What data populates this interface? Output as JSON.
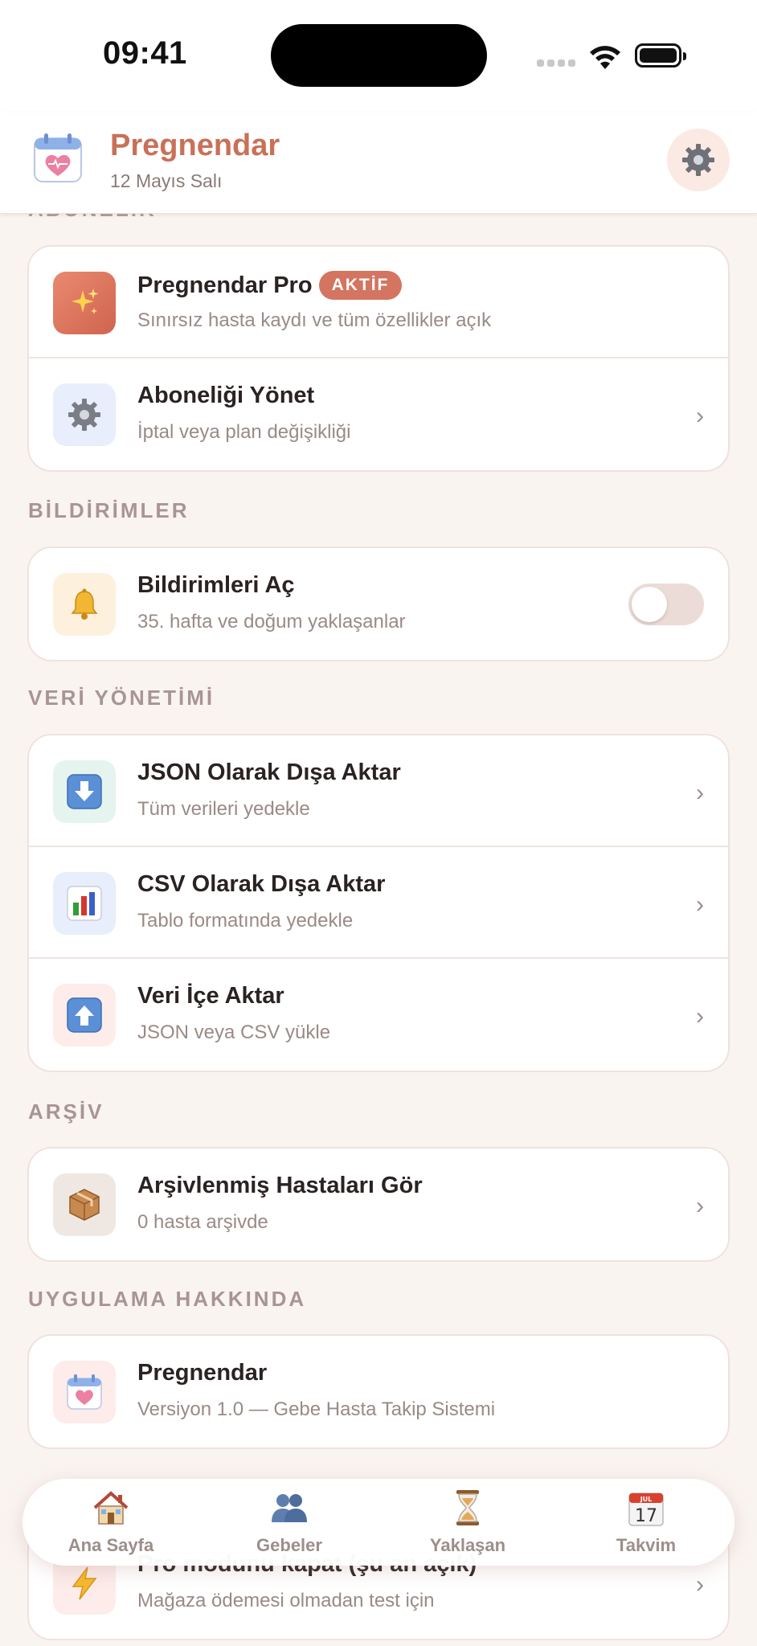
{
  "status_bar": {
    "time": "09:41"
  },
  "header": {
    "title": "Pregnendar",
    "date": "12 Mayıs Salı"
  },
  "sections": {
    "subscriptions": {
      "title": "ABONELİK",
      "items": [
        {
          "title": "Pregnendar Pro",
          "badge": "AKTİF",
          "subtitle": "Sınırsız hasta kaydı ve tüm özellikler açık",
          "icon": "sparkles-icon"
        },
        {
          "title": "Aboneliği Yönet",
          "subtitle": "İptal veya plan değişikliği",
          "icon": "gear-icon"
        }
      ]
    },
    "notifications": {
      "title": "BİLDİRİMLER",
      "items": [
        {
          "title": "Bildirimleri Aç",
          "subtitle": "35. hafta ve doğum yaklaşanlar",
          "icon": "bell-icon",
          "enabled": false
        }
      ]
    },
    "data_management": {
      "title": "VERİ YÖNETİMİ",
      "items": [
        {
          "title": "JSON Olarak Dışa Aktar",
          "subtitle": "Tüm verileri yedekle",
          "icon": "download-arrow-icon"
        },
        {
          "title": "CSV Olarak Dışa Aktar",
          "subtitle": "Tablo formatında yedekle",
          "icon": "bar-chart-icon"
        },
        {
          "title": "Veri İçe Aktar",
          "subtitle": "JSON veya CSV yükle",
          "icon": "upload-arrow-icon"
        }
      ]
    },
    "archive": {
      "title": "ARŞİV",
      "items": [
        {
          "title": "Arşivlenmiş Hastaları Gör",
          "subtitle": "0 hasta arşivde",
          "icon": "package-icon"
        }
      ]
    },
    "about": {
      "title": "UYGULAMA HAKKINDA",
      "items": [
        {
          "title": "Pregnendar",
          "subtitle": "Versiyon 1.0 — Gebe Hasta Takip Sistemi",
          "icon": "app-calendar-heart-icon"
        }
      ]
    },
    "developer": {
      "items": [
        {
          "title": "Pro modunu kapat (şu an açık)",
          "subtitle": "Mağaza ödemesi olmadan test için",
          "icon": "lightning-icon"
        }
      ]
    }
  },
  "tabbar": {
    "tabs": [
      {
        "label": "Ana Sayfa",
        "icon": "house-icon"
      },
      {
        "label": "Gebeler",
        "icon": "people-icon"
      },
      {
        "label": "Yaklaşan",
        "icon": "hourglass-icon"
      },
      {
        "label": "Takvim",
        "icon": "calendar-icon"
      }
    ],
    "calendar_day": "17",
    "calendar_month": "JUL"
  },
  "colors": {
    "accent": "#c97058",
    "badge": "#d37560",
    "background": "#faf4f1",
    "muted_text": "#9a8a86"
  }
}
